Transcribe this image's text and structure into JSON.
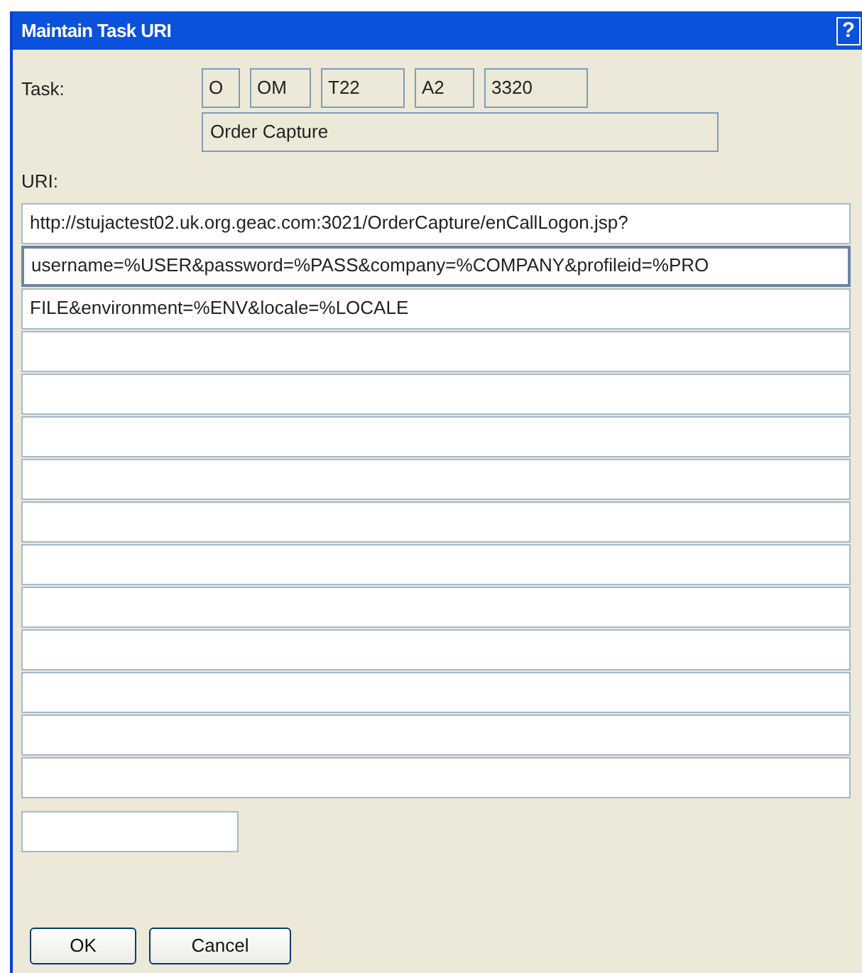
{
  "window": {
    "title": "Maintain Task URI",
    "help": "?"
  },
  "task": {
    "label": "Task:",
    "codes": [
      "O",
      "OM",
      "T22",
      "A2",
      "3320"
    ],
    "description": "Order Capture"
  },
  "uri": {
    "label": "URI:",
    "fields": [
      {
        "kind": "wide",
        "value": "http://stujactest02.uk.org.geac.com:3021/OrderCapture/enCallLogon.jsp?",
        "focused": false
      },
      {
        "kind": "wide",
        "value": "username=%USER&password=%PASS&company=%COMPANY&profileid=%PRO",
        "focused": true
      },
      {
        "kind": "wide",
        "value": "FILE&environment=%ENV&locale=%LOCALE",
        "focused": false
      },
      {
        "kind": "wide",
        "focused": false
      },
      {
        "kind": "wide",
        "focused": false
      },
      {
        "kind": "wide",
        "focused": false
      },
      {
        "kind": "wide",
        "focused": false
      },
      {
        "kind": "wide",
        "focused": false
      },
      {
        "kind": "wide",
        "focused": false
      },
      {
        "kind": "wide",
        "focused": false
      },
      {
        "kind": "wide",
        "focused": false
      },
      {
        "kind": "wide",
        "focused": false
      },
      {
        "kind": "wide",
        "focused": false
      },
      {
        "kind": "wide",
        "focused": false
      },
      {
        "kind": "short",
        "focused": false
      }
    ]
  },
  "buttons": [
    "OK",
    "Cancel"
  ]
}
